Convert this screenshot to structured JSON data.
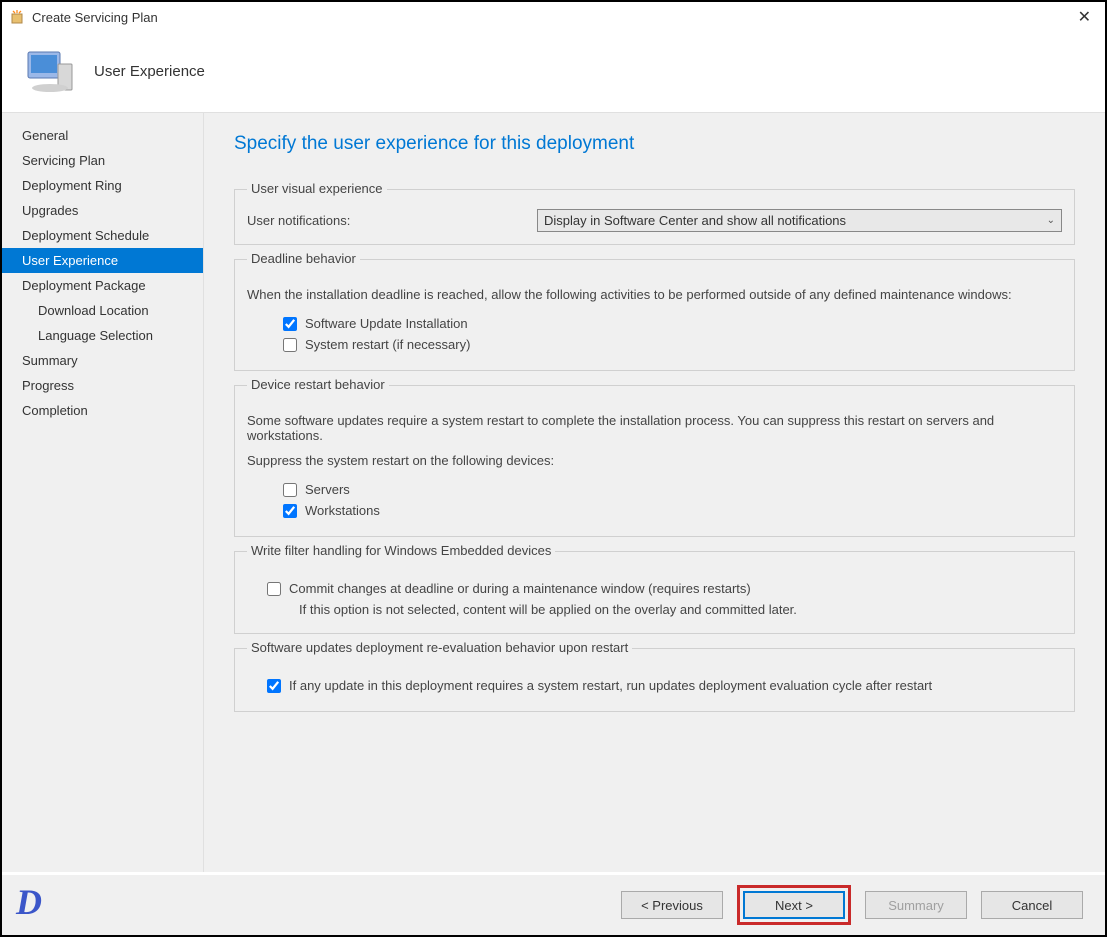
{
  "window": {
    "title": "Create Servicing Plan"
  },
  "header": {
    "title": "User Experience"
  },
  "sidebar": {
    "items": [
      {
        "label": "General",
        "active": false
      },
      {
        "label": "Servicing Plan",
        "active": false
      },
      {
        "label": "Deployment Ring",
        "active": false
      },
      {
        "label": "Upgrades",
        "active": false
      },
      {
        "label": "Deployment Schedule",
        "active": false
      },
      {
        "label": "User Experience",
        "active": true
      },
      {
        "label": "Deployment Package",
        "active": false
      },
      {
        "label": "Download Location",
        "active": false,
        "sub": true
      },
      {
        "label": "Language Selection",
        "active": false,
        "sub": true
      },
      {
        "label": "Summary",
        "active": false
      },
      {
        "label": "Progress",
        "active": false
      },
      {
        "label": "Completion",
        "active": false
      }
    ]
  },
  "content": {
    "page_title": "Specify the user experience for this deployment",
    "visual_experience": {
      "legend": "User visual experience",
      "notif_label": "User notifications:",
      "notif_value": "Display in Software Center and show all notifications"
    },
    "deadline": {
      "legend": "Deadline behavior",
      "description": "When the installation deadline is reached, allow the following activities to be performed outside of any defined maintenance windows:",
      "opt1_label": "Software Update Installation",
      "opt1_checked": true,
      "opt2_label": "System restart (if necessary)",
      "opt2_checked": false
    },
    "device_restart": {
      "legend": "Device restart behavior",
      "description": "Some software updates require a system restart to complete the installation process. You can suppress this restart on servers and workstations.",
      "prompt": "Suppress the system restart on the following devices:",
      "opt1_label": "Servers",
      "opt1_checked": false,
      "opt2_label": "Workstations",
      "opt2_checked": true
    },
    "write_filter": {
      "legend": "Write filter handling for Windows Embedded devices",
      "opt_label": "Commit changes at deadline or during a maintenance window (requires restarts)",
      "opt_checked": false,
      "note": "If this option is not selected, content will be applied on the overlay and committed later."
    },
    "reeval": {
      "legend": "Software updates deployment re-evaluation behavior upon restart",
      "opt_label": "If any update in this deployment requires a system restart, run updates deployment evaluation cycle after restart",
      "opt_checked": true
    }
  },
  "footer": {
    "previous": "< Previous",
    "next": "Next >",
    "summary": "Summary",
    "cancel": "Cancel"
  },
  "logo": "D"
}
